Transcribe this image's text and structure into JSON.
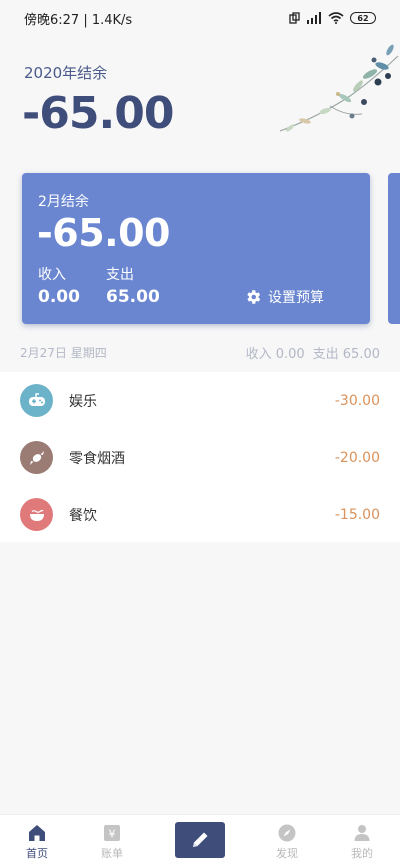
{
  "status_bar": {
    "time_speed": "傍晚6:27 | 1.4K/s",
    "battery": "62"
  },
  "header": {
    "year_label": "2020年结余",
    "year_amount": "-65.00"
  },
  "card": {
    "month_label": "2月结余",
    "balance": "-65.00",
    "income_label": "收入",
    "income_value": "0.00",
    "expense_label": "支出",
    "expense_value": "65.00",
    "budget_label": "设置预算"
  },
  "day": {
    "date": "2月27日 星期四",
    "income": "收入 0.00",
    "expense": "支出 65.00"
  },
  "transactions": [
    {
      "category": "娱乐",
      "amount": "-30.00",
      "icon": "gamepad-icon",
      "color": "#6cb3c9"
    },
    {
      "category": "零食烟酒",
      "amount": "-20.00",
      "icon": "candy-icon",
      "color": "#9a7c74"
    },
    {
      "category": "餐饮",
      "amount": "-15.00",
      "icon": "bowl-icon",
      "color": "#e07a7a"
    }
  ],
  "nav": {
    "home": "首页",
    "bills": "账单",
    "discover": "发现",
    "mine": "我的"
  },
  "colors": {
    "primary": "#3f4d7a",
    "card": "#6a86d0",
    "expense": "#d9925b",
    "muted": "#b3b8c6"
  }
}
